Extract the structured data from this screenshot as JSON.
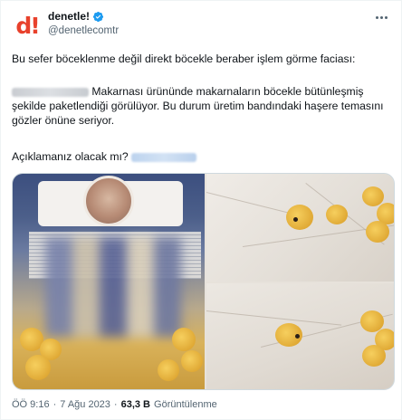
{
  "author": {
    "display_name": "denetle!",
    "handle": "@denetlecomtr",
    "avatar_text": "d!",
    "verified": true
  },
  "tweet": {
    "paragraph1": "Bu sefer böceklenme değil direkt böcekle beraber işlem görme faciası:",
    "paragraph2": "Makarnası ürününde makarnaların böcekle bütünleşmiş şekilde paketlendiği görülüyor. Bu durum üretim bandındaki haşere temasını gözler önüne seriyor.",
    "paragraph3": "Açıklamanız olacak mı?"
  },
  "footer": {
    "time": "ÖÖ 9:16",
    "separator": "·",
    "date": "7 Ağu 2023",
    "view_count": "63,3 B",
    "view_label": "Görüntülenme"
  },
  "icons": {
    "verified": "verified-badge-icon",
    "more": "more-options-icon"
  },
  "colors": {
    "brand": "#e8412c",
    "verified": "#1d9bf0",
    "secondary_text": "#536471"
  }
}
